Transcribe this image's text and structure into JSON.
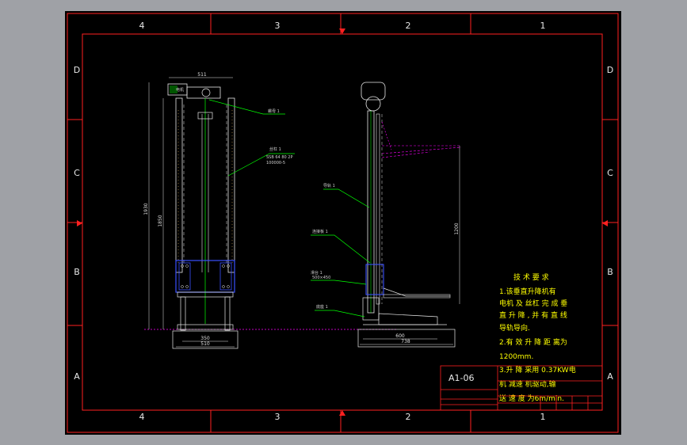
{
  "colors": {
    "background": "#9fa1a6",
    "sheet": "#000000",
    "frame": "#ff2020",
    "drawing": "#e8e8e8",
    "leader": "#00ff00",
    "hidden": "#ff00ff",
    "notes": "#ffff00",
    "component": "#3a50ff"
  },
  "zones": {
    "columns": [
      "4",
      "3",
      "2",
      "1"
    ],
    "rows": [
      "D",
      "C",
      "B",
      "A"
    ]
  },
  "front_view": {
    "dims": {
      "top_width": "511",
      "height_outer": "1930",
      "height_inner": "1850",
      "base_inner": "350",
      "base_outer": "510"
    },
    "labels": {
      "motor": "电机",
      "nut": "螺母 1",
      "screw_title": "丝杠 1",
      "screw_spec1": "SSB 64 80 2P",
      "screw_spec2": "100000-5"
    }
  },
  "side_view": {
    "dims": {
      "lift_height": "1200",
      "base_inner": "600",
      "base_outer": "738"
    },
    "labels": {
      "guide": "导轨 1",
      "plate": "连接板 1",
      "slide": "滑台 1",
      "slide_size": "500×450",
      "base": "底座 1"
    }
  },
  "notes": {
    "title": "技 术 要 求",
    "lines": [
      "1.该垂直升降机有",
      "电机 及 丝杠 完 成 垂",
      "直 升 降 , 并 有 直 线",
      "导轨导向.",
      "2.有 效 升 降 距 离为",
      "1200mm.",
      "3.升 降 采用 0.37KW电",
      "机 减速 机驱动,输",
      "送 速 度 为6m/min."
    ]
  },
  "title_block": {
    "drawing_number": "A1-06"
  }
}
